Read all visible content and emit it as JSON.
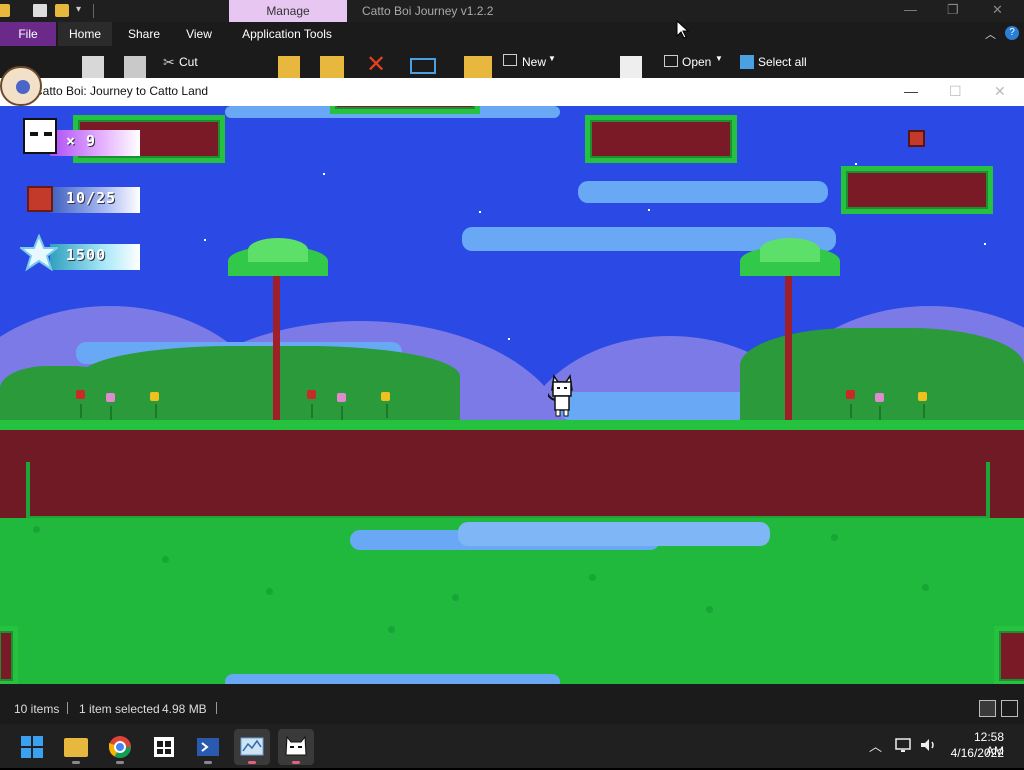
{
  "explorer": {
    "manage_tab": "Manage",
    "window_title": "Catto Boi Journey v1.2.2",
    "tabs": [
      "File",
      "Home",
      "Share",
      "View",
      "Application Tools"
    ],
    "ribbon": {
      "cut": "Cut",
      "new": "New",
      "open": "Open",
      "select_all": "Select all"
    }
  },
  "game_window": {
    "title": "Catto Boi: Journey to Catto Land"
  },
  "hud": {
    "lives": "× 9",
    "crates": "10/25",
    "score": "1500"
  },
  "status_bar": {
    "items": "10 items",
    "selected": "1 item selected",
    "size": "4.98 MB"
  },
  "taskbar": {
    "apps": [
      "Start",
      "File Explorer",
      "Chrome",
      "Microsoft Store",
      "PowerShell",
      "Resource Monitor",
      "Catto Boi"
    ],
    "time": "12:58 AM",
    "date": "4/16/2022"
  },
  "colors": {
    "sky": "#2b49e5",
    "grass": "#24c23f",
    "dirt": "#6f1a25",
    "file_tab": "#6b2a8a",
    "manage_tab": "#e7c6f2"
  }
}
